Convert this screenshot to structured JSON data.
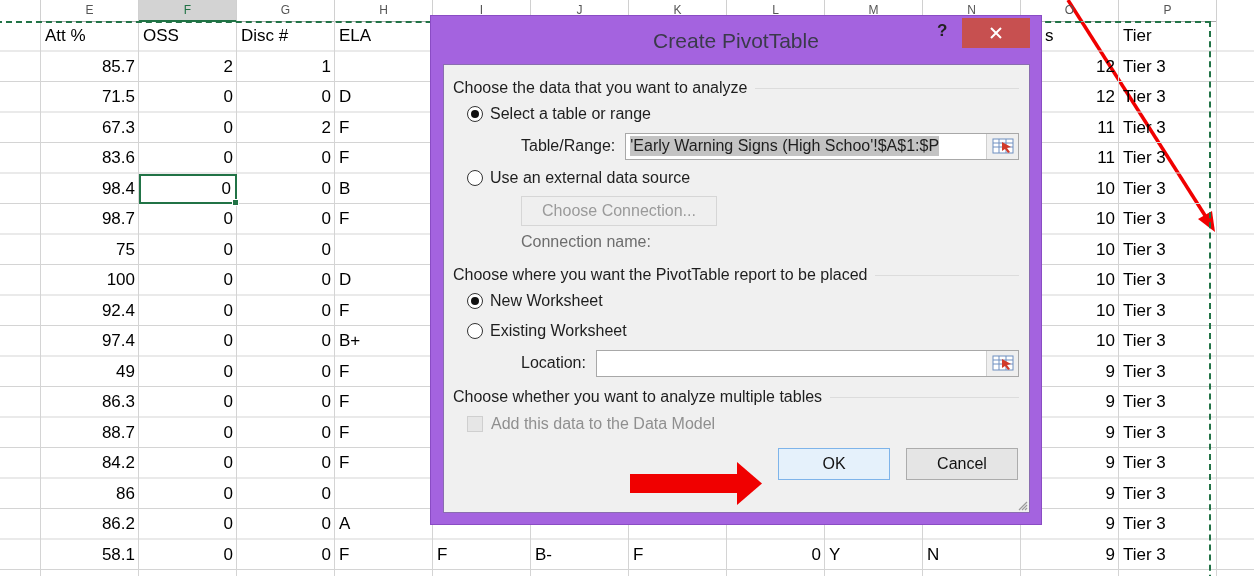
{
  "sheet": {
    "columns": [
      {
        "letter": "E",
        "selected": false
      },
      {
        "letter": "F",
        "selected": true
      },
      {
        "letter": "G",
        "selected": false
      },
      {
        "letter": "H",
        "selected": false
      },
      {
        "letter": "I",
        "selected": false
      },
      {
        "letter": "J",
        "selected": false
      },
      {
        "letter": "K",
        "selected": false
      },
      {
        "letter": "L",
        "selected": false
      },
      {
        "letter": "M",
        "selected": false
      },
      {
        "letter": "N",
        "selected": false
      },
      {
        "letter": "O",
        "selected": false
      },
      {
        "letter": "P",
        "selected": false
      }
    ],
    "header_row": {
      "e": "Att %",
      "f": "OSS",
      "g": "Disc #",
      "h": "ELA",
      "o": "s",
      "p": "Tier"
    },
    "rows": [
      {
        "e": "85.7",
        "f": "2",
        "g": "1",
        "o": "12",
        "p": "Tier 3",
        "selected": false
      },
      {
        "e": "71.5",
        "f": "0",
        "g": "0",
        "h": "D",
        "o": "12",
        "p": "Tier 3",
        "selected": false
      },
      {
        "e": "67.3",
        "f": "0",
        "g": "2",
        "h": "F",
        "o": "11",
        "p": "Tier 3",
        "selected": false
      },
      {
        "e": "83.6",
        "f": "0",
        "g": "0",
        "h": "F",
        "o": "11",
        "p": "Tier 3",
        "selected": false
      },
      {
        "e": "98.4",
        "f": "0",
        "g": "0",
        "h": "B",
        "o": "10",
        "p": "Tier 3",
        "selected": true
      },
      {
        "e": "98.7",
        "f": "0",
        "g": "0",
        "h": "F",
        "o": "10",
        "p": "Tier 3",
        "selected": false
      },
      {
        "e": "75",
        "f": "0",
        "g": "0",
        "o": "10",
        "p": "Tier 3",
        "selected": false
      },
      {
        "e": "100",
        "f": "0",
        "g": "0",
        "h": "D",
        "o": "10",
        "p": "Tier 3",
        "selected": false
      },
      {
        "e": "92.4",
        "f": "0",
        "g": "0",
        "h": "F",
        "o": "10",
        "p": "Tier 3",
        "selected": false
      },
      {
        "e": "97.4",
        "f": "0",
        "g": "0",
        "h": "B+",
        "o": "10",
        "p": "Tier 3",
        "selected": false
      },
      {
        "e": "49",
        "f": "0",
        "g": "0",
        "h": "F",
        "o": "9",
        "p": "Tier 3",
        "selected": false
      },
      {
        "e": "86.3",
        "f": "0",
        "g": "0",
        "h": "F",
        "o": "9",
        "p": "Tier 3",
        "selected": false
      },
      {
        "e": "88.7",
        "f": "0",
        "g": "0",
        "h": "F",
        "o": "9",
        "p": "Tier 3",
        "selected": false
      },
      {
        "e": "84.2",
        "f": "0",
        "g": "0",
        "h": "F",
        "o": "9",
        "p": "Tier 3",
        "selected": false
      },
      {
        "e": "86",
        "f": "0",
        "g": "0",
        "o": "9",
        "p": "Tier 3",
        "selected": false
      },
      {
        "e": "86.2",
        "f": "0",
        "g": "0",
        "h": "A",
        "o": "9",
        "p": "Tier 3",
        "selected": false
      },
      {
        "e": "58.1",
        "f": "0",
        "g": "0",
        "h": "F",
        "i": "F",
        "j": "B-",
        "k": "F",
        "l": "0",
        "m": "Y",
        "n": "N",
        "o": "9",
        "p": "Tier 3",
        "selected": false
      }
    ]
  },
  "dialog": {
    "title": "Create PivotTable",
    "help": "?",
    "sections": [
      {
        "heading": "Choose the data that you want to analyze",
        "options": [
          {
            "label": "Select a table or range",
            "selected": true,
            "field": {
              "label": "Table/Range:",
              "value": "'Early Warning Signs (High Schoo'!$A$1:$P",
              "highlighted": true
            }
          },
          {
            "label": "Use an external data source",
            "selected": false,
            "button": {
              "label": "Choose Connection...",
              "disabled": true
            },
            "note": "Connection name:"
          }
        ]
      },
      {
        "heading": "Choose where you want the PivotTable report to be placed",
        "options": [
          {
            "label": "New Worksheet",
            "selected": true
          },
          {
            "label": "Existing Worksheet",
            "selected": false,
            "field": {
              "label": "Location:"
            }
          }
        ]
      },
      {
        "heading": "Choose whether you want to analyze multiple tables",
        "checkbox": {
          "label": "Add this data to the Data Model",
          "checked": false,
          "disabled": true
        }
      }
    ],
    "buttons": [
      {
        "label": "OK",
        "default": true
      },
      {
        "label": "Cancel",
        "default": false
      }
    ]
  }
}
